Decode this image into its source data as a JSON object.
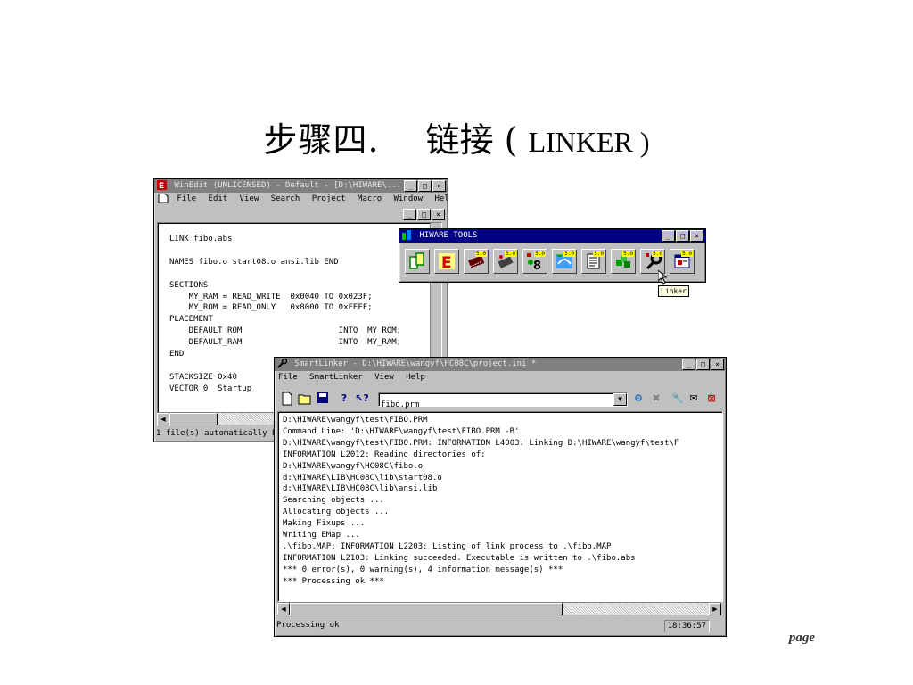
{
  "slide": {
    "title_part1": "步骤四.",
    "title_part2": "链接 (",
    "title_part3": "LINKER )",
    "page_label": "page"
  },
  "winedit": {
    "title": "WinEdit (UNLICENSED) - Default - [D:\\HIWARE\\...",
    "menu": [
      "File",
      "Edit",
      "View",
      "Search",
      "Project",
      "Macro",
      "Window",
      "Help"
    ],
    "code_lines": [
      "LINK fibo.abs",
      "",
      "NAMES fibo.o start08.o ansi.lib END",
      "",
      "SECTIONS",
      "    MY_RAM = READ_WRITE  0x0040 TO 0x023F;",
      "    MY_ROM = READ_ONLY   0x8000 TO 0xFEFF;",
      "PLACEMENT",
      "    DEFAULT_ROM                    INTO  MY_ROM;",
      "    DEFAULT_RAM                    INTO  MY_RAM;",
      "END",
      "",
      "STACKSIZE 0x40",
      "VECTOR 0 _Startup"
    ],
    "status": "1 file(s) automatically b"
  },
  "hiware": {
    "title": "HIWARE TOOLS",
    "tools": [
      {
        "icon": "project-icon",
        "badge": ""
      },
      {
        "icon": "editor-icon",
        "badge": ""
      },
      {
        "icon": "compiler-icon",
        "badge": "5.0"
      },
      {
        "icon": "assembler-icon",
        "badge": "5.0"
      },
      {
        "icon": "burner-icon",
        "badge": "5.0"
      },
      {
        "icon": "decoder-icon",
        "badge": "5.0"
      },
      {
        "icon": "maker-icon",
        "badge": "5.0"
      },
      {
        "icon": "libmaker-icon",
        "badge": "5.0"
      },
      {
        "icon": "linker-icon",
        "badge": "5.0"
      },
      {
        "icon": "simulator-icon",
        "badge": "5.0"
      }
    ],
    "tooltip": "Linker"
  },
  "smartlinker": {
    "title": "SmartLinker - D:\\HIWARE\\wangyf\\HC08C\\project.ini *",
    "menu": [
      "File",
      "SmartLinker",
      "View",
      "Help"
    ],
    "file_value": "fibo.prm",
    "output_lines": [
      "D:\\HIWARE\\wangyf\\test\\FIBO.PRM",
      "Command Line: 'D:\\HIWARE\\wangyf\\test\\FIBO.PRM -B'",
      "D:\\HIWARE\\wangyf\\test\\FIBO.PRM: INFORMATION L4003: Linking D:\\HIWARE\\wangyf\\test\\F",
      "INFORMATION L2012: Reading directories of:",
      "D:\\HIWARE\\wangyf\\HC08C\\fibo.o",
      "d:\\HIWARE\\LIB\\HC08C\\lib\\start08.o",
      "d:\\HIWARE\\LIB\\HC08C\\lib\\ansi.lib",
      "Searching objects ...",
      "Allocating objects ...",
      "Making Fixups ...",
      "Writing EMap ...",
      ".\\fibo.MAP: INFORMATION L2203: Listing of link process to .\\fibo.MAP",
      "INFORMATION L2103: Linking succeeded. Executable is written to .\\fibo.abs",
      "*** 0 error(s), 0 warning(s), 4 information message(s) ***",
      "*** Processing ok ***"
    ],
    "status_text": "Processing ok",
    "status_time": "18:36:57"
  },
  "window_buttons": {
    "minimize": "_",
    "restore": "□",
    "maximize": "□",
    "close": "×"
  },
  "colors": {
    "active_title": "#000080",
    "inactive_title": "#808080",
    "face": "#c0c0c0"
  }
}
